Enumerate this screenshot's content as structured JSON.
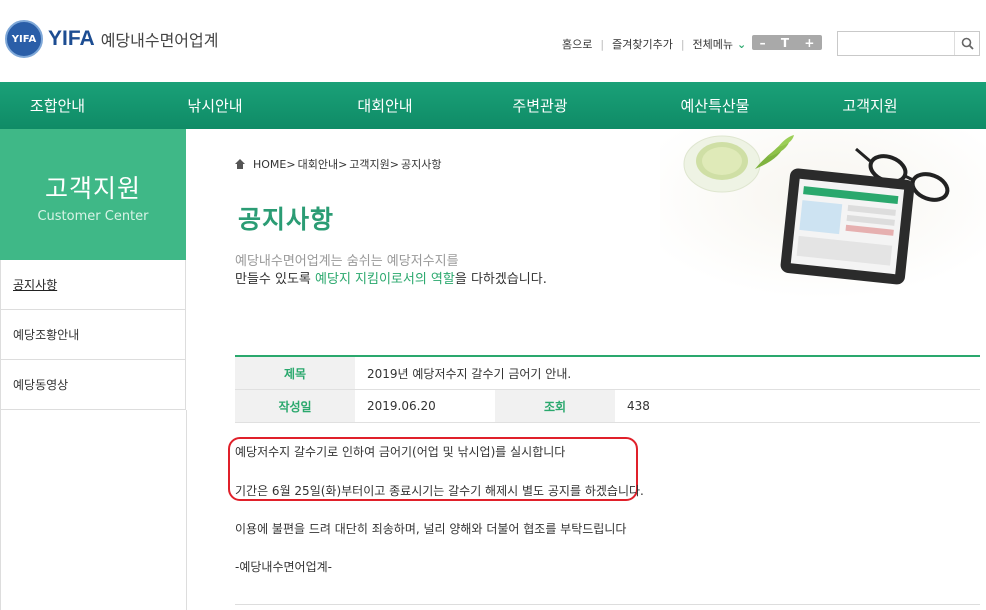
{
  "header": {
    "logo_mark": "YIFA",
    "logo_brand": "YIFA",
    "logo_name": "예당내수면어업계",
    "util": {
      "home": "홈으로",
      "bookmark": "즐겨찾기추가",
      "all_menu": "전체메뉴"
    },
    "font_controls": [
      "–",
      "T",
      "+"
    ],
    "search": {
      "value": "",
      "placeholder": ""
    }
  },
  "nav": {
    "items": [
      "조합안내",
      "낚시안내",
      "대회안내",
      "주변관광",
      "예산특산물",
      "고객지원"
    ]
  },
  "sidebar": {
    "title_ko": "고객지원",
    "title_en": "Customer Center",
    "items": [
      "공지사항",
      "예당조황안내",
      "예당동영상"
    ],
    "active_index": 0
  },
  "breadcrumb": {
    "items": [
      "HOME>",
      "대회안내>",
      "고객지원>",
      "공지사항"
    ]
  },
  "page": {
    "title": "공지사항",
    "slogan_line1": "예당내수면어업계는 숨쉬는 예당저수지를",
    "slogan_line2_a": "만들수 있도록 ",
    "slogan_line2_hl": "예당지 지킴이로서의 역할",
    "slogan_line2_b": "을 다하겠습니다."
  },
  "post": {
    "subject_label": "제목",
    "subject": "2019년 예당저수지 갈수기 금어기 안내.",
    "date_label": "작성일",
    "date": "2019.06.20",
    "views_label": "조회",
    "views": "438",
    "body": [
      "예당저수지 갈수기로 인하여 금어기(어업 및 낚시업)를 실시합니다",
      "기간은 6월 25일(화)부터이고 종료시기는 갈수기 해제시 별도 공지를 하겠습니다.",
      "이용에 불편을 드려 대단히 죄송하며, 널리 양해와 더불어 협조를 부탁드립니다",
      "-예당내수면어업계-"
    ]
  },
  "colors": {
    "brand_green": "#2aa86d",
    "nav_green": "#14946e",
    "sidebar_green": "#3fb887",
    "logo_blue": "#1d4d92",
    "highlight_red": "#e0202a"
  }
}
